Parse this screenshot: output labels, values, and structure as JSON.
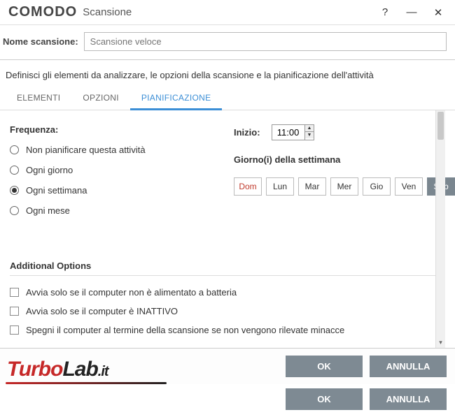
{
  "titlebar": {
    "brand": "COMODO",
    "subtitle": "Scansione"
  },
  "scan_name": {
    "label": "Nome scansione:",
    "placeholder": "Scansione veloce"
  },
  "description": "Definisci gli elementi da analizzare, le opzioni della scansione e la pianificazione dell'attività",
  "tabs": {
    "elements": "ELEMENTI",
    "options": "OPZIONI",
    "schedule": "PIANIFICAZIONE"
  },
  "frequency": {
    "label": "Frequenza:",
    "opts": {
      "none": "Non pianificare questa attività",
      "daily": "Ogni giorno",
      "weekly": "Ogni settimana",
      "monthly": "Ogni mese"
    }
  },
  "start": {
    "label": "Inizio:",
    "value": "11:00"
  },
  "weekdays": {
    "label": "Giorno(i) della settimana",
    "days": {
      "sun": "Dom",
      "mon": "Lun",
      "tue": "Mar",
      "wed": "Mer",
      "thu": "Gio",
      "fri": "Ven",
      "sat": "Sab"
    }
  },
  "additional": {
    "title": "Additional Options",
    "opt1": "Avvia solo se il computer non è alimentato a batteria",
    "opt2": "Avvia solo se il computer è INATTIVO",
    "opt3": "Spegni il computer al termine della scansione se non vengono rilevate minacce"
  },
  "buttons": {
    "ok": "OK",
    "cancel": "ANNULLA"
  },
  "watermark": {
    "turbo": "Turbo",
    "lab": "Lab",
    "it": ".it"
  }
}
